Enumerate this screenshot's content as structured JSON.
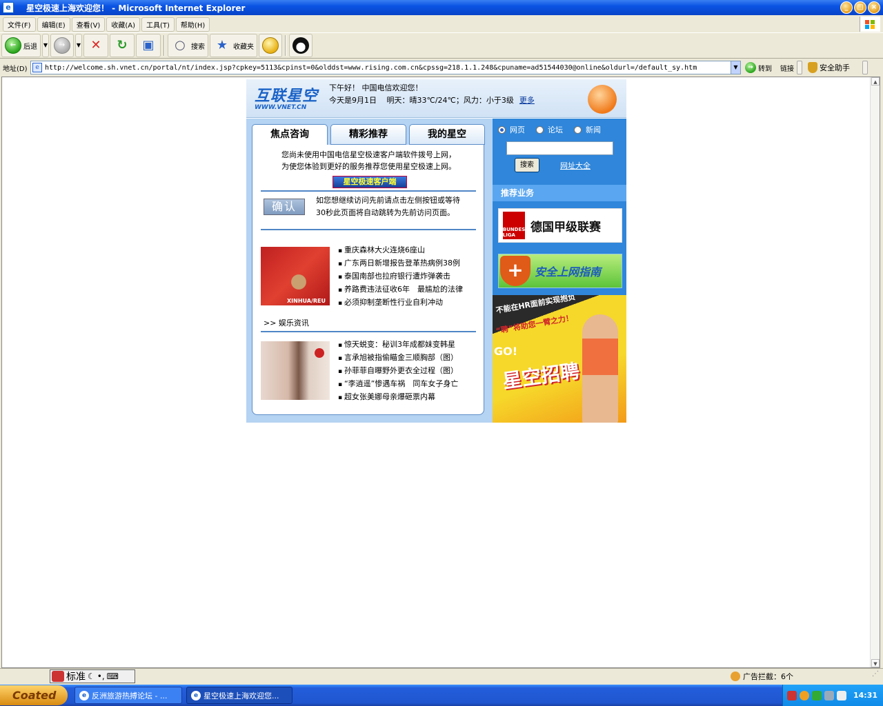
{
  "window": {
    "title": "星空极速上海欢迎您！ - Microsoft Internet Explorer",
    "controls": [
      "_",
      "□",
      "×"
    ]
  },
  "menu": [
    "文件(F)",
    "编辑(E)",
    "查看(V)",
    "收藏(A)",
    "工具(T)",
    "帮助(H)"
  ],
  "toolbar": {
    "back": "后退",
    "search": "搜索",
    "favorites": "收藏夹"
  },
  "address": {
    "label": "地址(D)",
    "url": "http://welcome.sh.vnet.cn/portal/nt/index.jsp?cpkey=5113&cpinst=0&olddst=www.rising.com.cn&cpssg=218.1.1.248&cpuname=ad51544030@online&oldurl=/default_sy.htm",
    "go": "转到",
    "links": "链接",
    "safety": "安全助手"
  },
  "page": {
    "logo_cn": "互联星空",
    "logo_en": "WWW.VNET.CN",
    "greeting": "下午好！ 中国电信欢迎您！",
    "weather": "今天是9月1日　 明天：晴33℃/24℃；风力：小于3级",
    "more": "更多",
    "tabs": [
      "焦点咨询",
      "精彩推荐",
      "我的星空"
    ],
    "notice_line1": "您尚未使用中国电信星空极速客户端软件拨号上网，",
    "notice_line2": "为使您体验到更好的服务推荐您使用星空极速上网。",
    "client_button": "星空极速客户端",
    "confirm_button": "确认",
    "notice2_line1": "如您想继续访问先前请点击左侧按钮或等待",
    "notice2_line2": "30秒此页面将自动跳转为先前访问页面。",
    "news_image_caption": "XINHUA/REU",
    "news": [
      "重庆森林大火连烧6座山",
      "广东两日新增报告登革热病例38例",
      "泰国南部也拉府银行遭炸弹袭击",
      "养路费违法征收6年　最尴尬的法律",
      "必须抑制垄断性行业自利冲动"
    ],
    "ent_section": ">> 娱乐资讯",
    "ent_news": [
      "惊天蜕变：秘训3年成都妹变韩星",
      "言承旭被指偷瞄金三顺胸部（图）",
      "孙菲菲自曝野外更衣全过程（图）",
      "“李逍遥”惨遇车祸　同车女子身亡",
      "超女张美娜母亲爆砸票内幕"
    ],
    "search_options": [
      "网页",
      "论坛",
      "新闻"
    ],
    "search_button": "搜索",
    "directory_link": "网址大全",
    "rec_title": "推荐业务",
    "bundesliga_logo": "BUNDES LIGA",
    "bundesliga_text": "德国甲级联赛",
    "safety_banner": "安全上网指南",
    "recruit_line1": "不能在HR面前实现抱负",
    "recruit_line2": "“聘”将助您一臂之力！",
    "recruit_go": "GO!",
    "recruit_big": "星空招聘"
  },
  "statusbar": {
    "ime": "标准",
    "ad_block": "广告拦截：6个"
  },
  "taskbar": {
    "start": "Coated",
    "tasks": [
      "反洲旅游热搏论坛 - ...",
      "星空极速上海欢迎您..."
    ],
    "clock": "14:31"
  },
  "colors": {
    "title_blue": "#0a54e3",
    "page_blue": "#2f86da",
    "panel_lightblue": "#b5d3f2"
  }
}
